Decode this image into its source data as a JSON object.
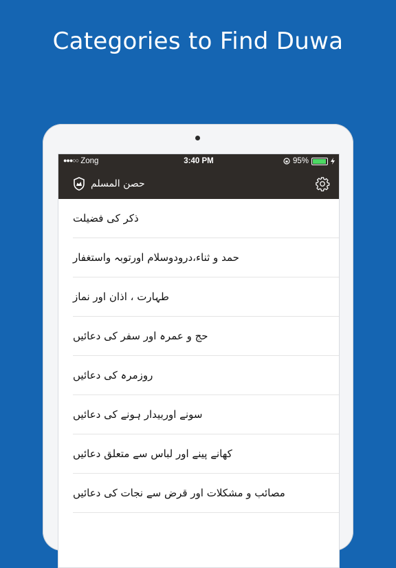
{
  "headline": "Categories to Find Duwa",
  "status": {
    "signal_dots": "●●●○○",
    "carrier": "Zong",
    "time": "3:40 PM",
    "battery_percent": "95%",
    "battery_level": 0.95
  },
  "nav": {
    "title": "حصن المسلم",
    "shield_icon": "shield-icon",
    "settings_icon": "gear-icon"
  },
  "categories": [
    "ذکر کی فضیلت",
    "حمد و ثناء،درودوسلام اورتوبہ واستغفار",
    "طہارت ، اذان اور نماز",
    "حج و عمرہ اور سفر کی دعائیں",
    "روزمرہ کی دعائیں",
    "سونے اوربیدار ہونے کی دعائیں",
    "کھانے پینے اور لباس سے متعلق دعائیں",
    "مصائب و مشکلات اور قرض سے نجات کی دعائیں"
  ],
  "colors": {
    "background": "#1565b2",
    "bar": "#2f2b28",
    "battery": "#4cd964"
  }
}
